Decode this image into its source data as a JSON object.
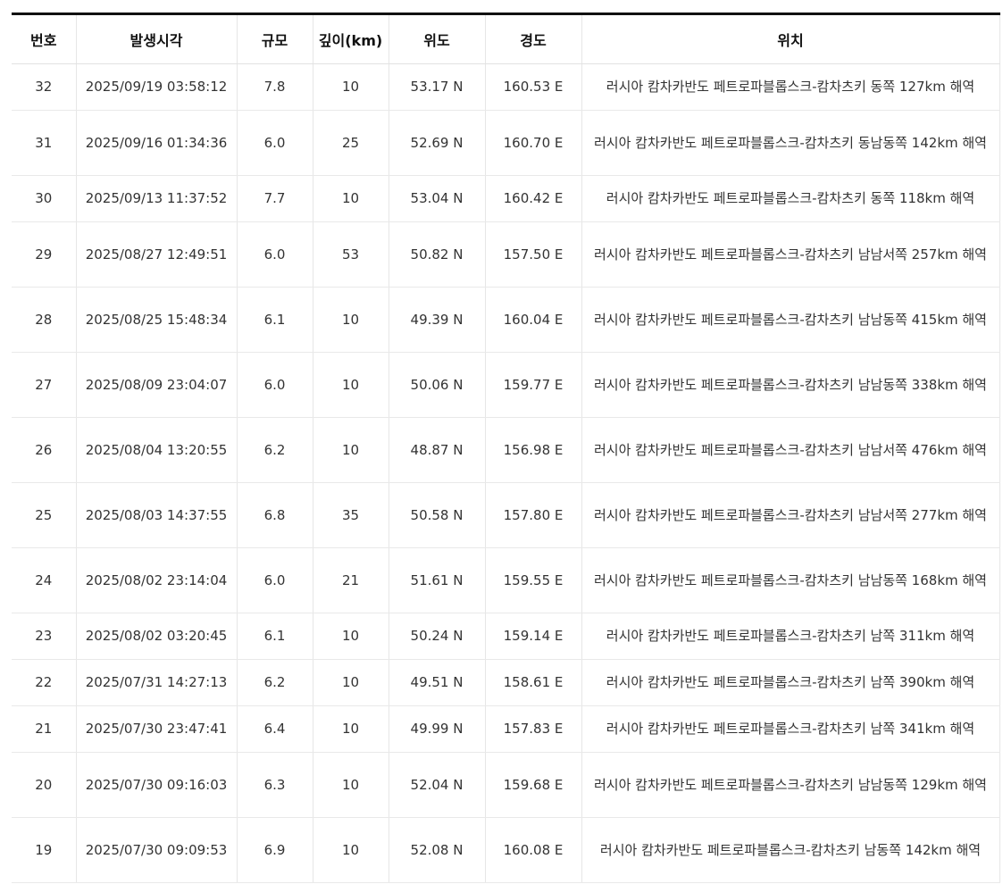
{
  "table": {
    "headers": [
      "번호",
      "발생시각",
      "규모",
      "깊이(km)",
      "위도",
      "경도",
      "위치"
    ],
    "rows": [
      {
        "no": "32",
        "time": "2025/09/19 03:58:12",
        "mag": "7.8",
        "depth": "10",
        "lat": "53.17 N",
        "lon": "160.53 E",
        "loc": "러시아 캄차카반도 페트로파블롭스크-캄차츠키 동쪽 127km 해역"
      },
      {
        "no": "31",
        "time": "2025/09/16 01:34:36",
        "mag": "6.0",
        "depth": "25",
        "lat": "52.69 N",
        "lon": "160.70 E",
        "loc": "러시아 캄차카반도 페트로파블롭스크-캄차츠키 동남동쪽 142km 해역"
      },
      {
        "no": "30",
        "time": "2025/09/13 11:37:52",
        "mag": "7.7",
        "depth": "10",
        "lat": "53.04 N",
        "lon": "160.42 E",
        "loc": "러시아 캄차카반도 페트로파블롭스크-캄차츠키 동쪽 118km 해역"
      },
      {
        "no": "29",
        "time": "2025/08/27 12:49:51",
        "mag": "6.0",
        "depth": "53",
        "lat": "50.82 N",
        "lon": "157.50 E",
        "loc": "러시아 캄차카반도 페트로파블롭스크-캄차츠키 남남서쪽 257km 해역"
      },
      {
        "no": "28",
        "time": "2025/08/25 15:48:34",
        "mag": "6.1",
        "depth": "10",
        "lat": "49.39 N",
        "lon": "160.04 E",
        "loc": "러시아 캄차카반도 페트로파블롭스크-캄차츠키 남남동쪽 415km 해역"
      },
      {
        "no": "27",
        "time": "2025/08/09 23:04:07",
        "mag": "6.0",
        "depth": "10",
        "lat": "50.06 N",
        "lon": "159.77 E",
        "loc": "러시아 캄차카반도 페트로파블롭스크-캄차츠키 남남동쪽 338km 해역"
      },
      {
        "no": "26",
        "time": "2025/08/04 13:20:55",
        "mag": "6.2",
        "depth": "10",
        "lat": "48.87 N",
        "lon": "156.98 E",
        "loc": "러시아 캄차카반도 페트로파블롭스크-캄차츠키 남남서쪽 476km 해역"
      },
      {
        "no": "25",
        "time": "2025/08/03 14:37:55",
        "mag": "6.8",
        "depth": "35",
        "lat": "50.58 N",
        "lon": "157.80 E",
        "loc": "러시아 캄차카반도 페트로파블롭스크-캄차츠키 남남서쪽 277km 해역"
      },
      {
        "no": "24",
        "time": "2025/08/02 23:14:04",
        "mag": "6.0",
        "depth": "21",
        "lat": "51.61 N",
        "lon": "159.55 E",
        "loc": "러시아 캄차카반도 페트로파블롭스크-캄차츠키 남남동쪽 168km 해역"
      },
      {
        "no": "23",
        "time": "2025/08/02 03:20:45",
        "mag": "6.1",
        "depth": "10",
        "lat": "50.24 N",
        "lon": "159.14 E",
        "loc": "러시아 캄차카반도 페트로파블롭스크-캄차츠키 남쪽 311km 해역"
      },
      {
        "no": "22",
        "time": "2025/07/31 14:27:13",
        "mag": "6.2",
        "depth": "10",
        "lat": "49.51 N",
        "lon": "158.61 E",
        "loc": "러시아 캄차카반도 페트로파블롭스크-캄차츠키 남쪽 390km 해역"
      },
      {
        "no": "21",
        "time": "2025/07/30 23:47:41",
        "mag": "6.4",
        "depth": "10",
        "lat": "49.99 N",
        "lon": "157.83 E",
        "loc": "러시아 캄차카반도 페트로파블롭스크-캄차츠키 남쪽 341km 해역"
      },
      {
        "no": "20",
        "time": "2025/07/30 09:16:03",
        "mag": "6.3",
        "depth": "10",
        "lat": "52.04 N",
        "lon": "159.68 E",
        "loc": "러시아 캄차카반도 페트로파블롭스크-캄차츠키 남남동쪽 129km 해역"
      },
      {
        "no": "19",
        "time": "2025/07/30 09:09:53",
        "mag": "6.9",
        "depth": "10",
        "lat": "52.08 N",
        "lon": "160.08 E",
        "loc": "러시아 캄차카반도 페트로파블롭스크-캄차츠키 남동쪽 142km 해역"
      }
    ]
  }
}
